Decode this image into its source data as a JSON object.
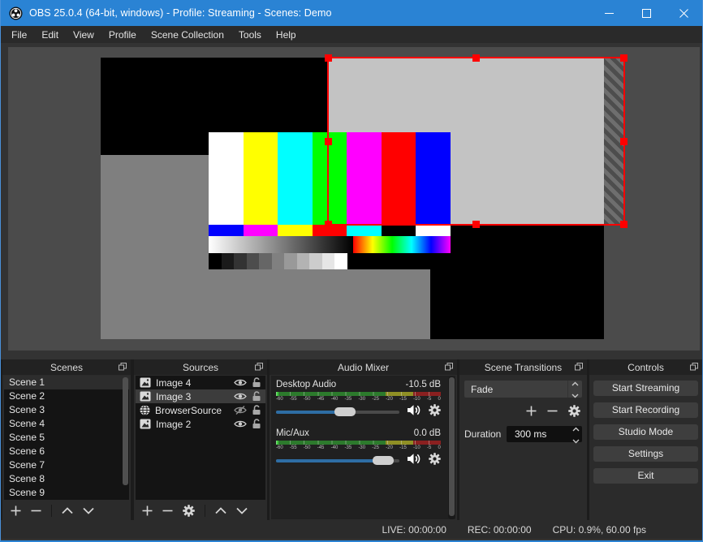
{
  "window": {
    "title": "OBS 25.0.4 (64-bit, windows) - Profile: Streaming - Scenes: Demo",
    "accent_blue": "#2a83d4"
  },
  "menu": {
    "items": [
      "File",
      "Edit",
      "View",
      "Profile",
      "Scene Collection",
      "Tools",
      "Help"
    ]
  },
  "preview": {
    "selection_color": "#ff0000",
    "pattern": {
      "bars": [
        "#ffffff",
        "#ffff00",
        "#00ffff",
        "#00ff00",
        "#ff00ff",
        "#ff0000",
        "#0000ff"
      ],
      "squares": [
        "#0000ff",
        "#ff00ff",
        "#ffff00",
        "#ff0000",
        "#00ffff",
        "#000000",
        "#ffffff"
      ],
      "steps": [
        "#000000",
        "#1a1a1a",
        "#333333",
        "#4d4d4d",
        "#666666",
        "#808080",
        "#999999",
        "#b3b3b3",
        "#cccccc",
        "#e6e6e6",
        "#ffffff"
      ]
    }
  },
  "panels": {
    "scenes": {
      "title": "Scenes",
      "selected_index": 0,
      "items": [
        "Scene 1",
        "Scene 2",
        "Scene 3",
        "Scene 4",
        "Scene 5",
        "Scene 6",
        "Scene 7",
        "Scene 8",
        "Scene 9"
      ]
    },
    "sources": {
      "title": "Sources",
      "items": [
        {
          "name": "Image 4",
          "icon": "image",
          "visible": true,
          "locked": false,
          "selected": false
        },
        {
          "name": "Image 3",
          "icon": "image",
          "visible": true,
          "locked": false,
          "selected": true
        },
        {
          "name": "BrowserSource",
          "icon": "globe",
          "visible": false,
          "locked": false,
          "selected": false
        },
        {
          "name": "Image 2",
          "icon": "image",
          "visible": true,
          "locked": false,
          "selected": false
        }
      ]
    },
    "audio_mixer": {
      "title": "Audio Mixer",
      "ticks": [
        "-60",
        "-55",
        "-50",
        "-45",
        "-40",
        "-35",
        "-30",
        "-25",
        "-20",
        "-15",
        "-10",
        "-5",
        "0"
      ],
      "meter_colors": {
        "peak": "#41cc41",
        "green": "#2c7a2c",
        "yellow": "#8f8f25",
        "red": "#8a2020"
      },
      "slider_color": "#2e6da4",
      "channels": [
        {
          "name": "Desktop Audio",
          "level": "-10.5 dB",
          "slider_pct": 56
        },
        {
          "name": "Mic/Aux",
          "level": "0.0 dB",
          "slider_pct": 87
        }
      ]
    },
    "transitions": {
      "title": "Scene Transitions",
      "current": "Fade",
      "duration_label": "Duration",
      "duration_value": "300 ms"
    },
    "controls": {
      "title": "Controls",
      "buttons": [
        "Start Streaming",
        "Start Recording",
        "Studio Mode",
        "Settings",
        "Exit"
      ]
    }
  },
  "statusbar": {
    "live": "LIVE: 00:00:00",
    "rec": "REC: 00:00:00",
    "cpu": "CPU: 0.9%, 60.00 fps"
  }
}
